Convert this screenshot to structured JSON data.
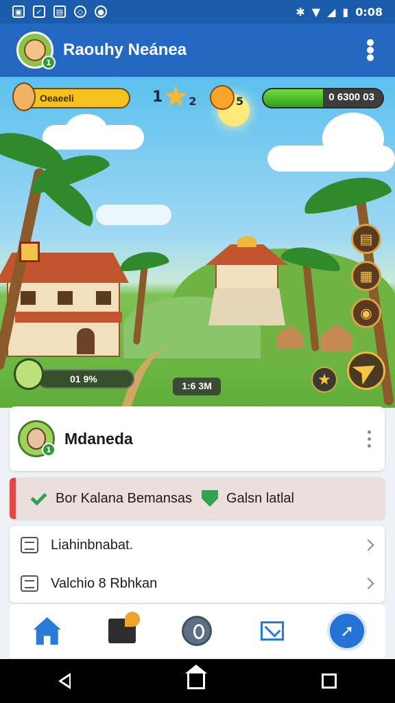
{
  "status_bar": {
    "time": "0:08",
    "icons": [
      "gallery-icon",
      "check-icon",
      "window-icon",
      "notification-icon",
      "sync-icon",
      "bluetooth-icon",
      "wifi-icon",
      "signal-icon",
      "battery-icon"
    ]
  },
  "app_bar": {
    "title": "Raouhy Neánea",
    "avatar_level": "1"
  },
  "hud": {
    "gold_label": "Oeaeeli",
    "stars_left": "1",
    "stars_right": "2",
    "coins": "5",
    "health_text": "0 6300 03",
    "health_fraction": 0.5,
    "player_value": "01 9%",
    "time_chip": "1:6 3M"
  },
  "profile": {
    "name": "Mdaneda",
    "level": "1"
  },
  "task": {
    "text_1": "Bor Kalana Bemansas",
    "text_2": "Galsn latlal",
    "accent": "#e34848"
  },
  "list": {
    "items": [
      {
        "label": "Liahinbnabat."
      },
      {
        "label": "Valchio 8 Rbhkan"
      }
    ]
  },
  "bottom_tabs": [
    "home-icon",
    "inventory-icon",
    "compass-icon",
    "mail-icon",
    "share-icon"
  ],
  "colors": {
    "app_bar": "#2468c1",
    "status_bar": "#1a5cab",
    "accent_blue": "#2472d6"
  }
}
